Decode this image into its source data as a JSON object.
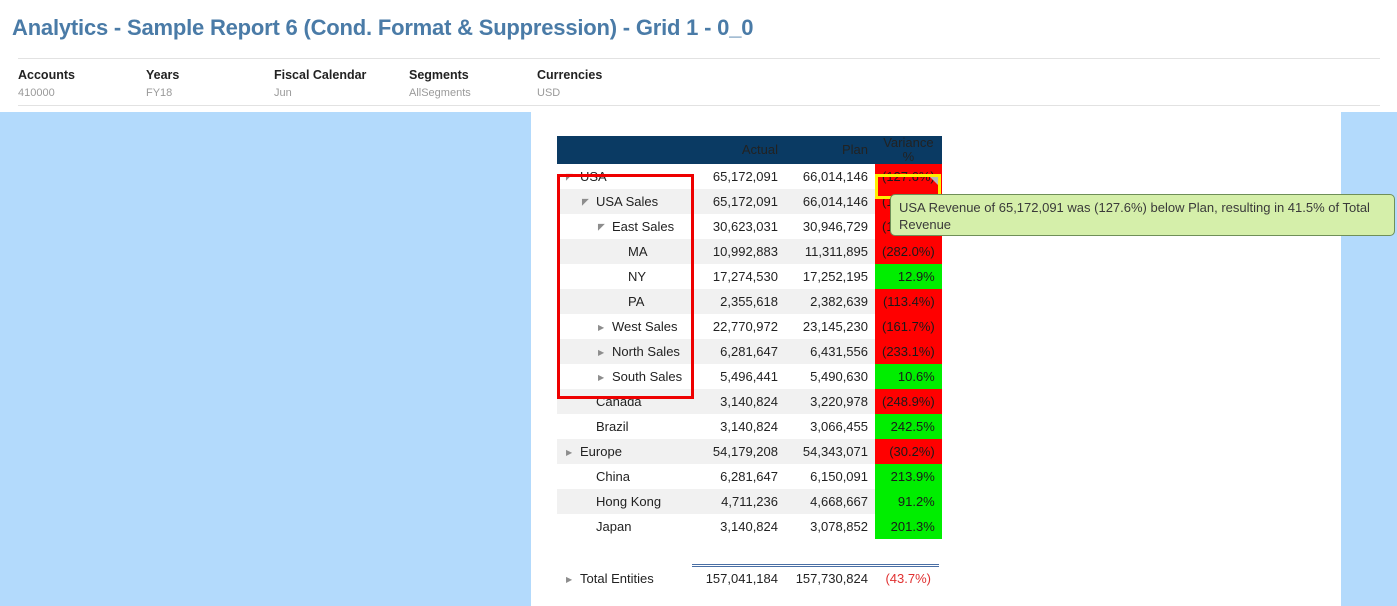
{
  "report": {
    "title": "Analytics - Sample Report 6 (Cond. Format & Suppression) - Grid 1 - 0_0"
  },
  "pov": [
    {
      "label": "Accounts",
      "value": "410000"
    },
    {
      "label": "Years",
      "value": "FY18"
    },
    {
      "label": "Fiscal Calendar",
      "value": "Jun"
    },
    {
      "label": "Segments",
      "value": "AllSegments"
    },
    {
      "label": "Currencies",
      "value": "USD"
    }
  ],
  "grid": {
    "columns": [
      "",
      "Actual",
      "Plan",
      "Variance %"
    ],
    "header": {
      "label": "",
      "actual": "Actual",
      "plan": "Plan",
      "variance_l1": "Variance",
      "variance_l2": "%"
    },
    "rows": [
      {
        "label": "USA",
        "level": 0,
        "toggle": "open",
        "actual": "65,172,091",
        "plan": "66,014,146",
        "variance": "(127.6%)",
        "variance_sign": "neg"
      },
      {
        "label": "USA Sales",
        "level": 1,
        "toggle": "open",
        "actual": "65,172,091",
        "plan": "66,014,146",
        "variance": "(127.6%)",
        "variance_sign": "neg"
      },
      {
        "label": "East Sales",
        "level": 2,
        "toggle": "open",
        "actual": "30,623,031",
        "plan": "30,946,729",
        "variance": "(164.6%)",
        "variance_sign": "neg"
      },
      {
        "label": "MA",
        "level": 3,
        "toggle": "none",
        "actual": "10,992,883",
        "plan": "11,311,895",
        "variance": "(282.0%)",
        "variance_sign": "neg"
      },
      {
        "label": "NY",
        "level": 3,
        "toggle": "none",
        "actual": "17,274,530",
        "plan": "17,252,195",
        "variance": "12.9%",
        "variance_sign": "pos"
      },
      {
        "label": "PA",
        "level": 3,
        "toggle": "none",
        "actual": "2,355,618",
        "plan": "2,382,639",
        "variance": "(113.4%)",
        "variance_sign": "neg"
      },
      {
        "label": "West Sales",
        "level": 2,
        "toggle": "closed",
        "actual": "22,770,972",
        "plan": "23,145,230",
        "variance": "(161.7%)",
        "variance_sign": "neg"
      },
      {
        "label": "North Sales",
        "level": 2,
        "toggle": "closed",
        "actual": "6,281,647",
        "plan": "6,431,556",
        "variance": "(233.1%)",
        "variance_sign": "neg"
      },
      {
        "label": "South Sales",
        "level": 2,
        "toggle": "closed",
        "actual": "5,496,441",
        "plan": "5,490,630",
        "variance": "10.6%",
        "variance_sign": "pos"
      },
      {
        "label": "Canada",
        "level": 1,
        "toggle": "none",
        "actual": "3,140,824",
        "plan": "3,220,978",
        "variance": "(248.9%)",
        "variance_sign": "neg"
      },
      {
        "label": "Brazil",
        "level": 1,
        "toggle": "none",
        "actual": "3,140,824",
        "plan": "3,066,455",
        "variance": "242.5%",
        "variance_sign": "pos"
      },
      {
        "label": "Europe",
        "level": 0,
        "toggle": "closed",
        "actual": "54,179,208",
        "plan": "54,343,071",
        "variance": "(30.2%)",
        "variance_sign": "neg"
      },
      {
        "label": "China",
        "level": 1,
        "toggle": "none",
        "actual": "6,281,647",
        "plan": "6,150,091",
        "variance": "213.9%",
        "variance_sign": "pos"
      },
      {
        "label": "Hong Kong",
        "level": 1,
        "toggle": "none",
        "actual": "4,711,236",
        "plan": "4,668,667",
        "variance": "91.2%",
        "variance_sign": "pos"
      },
      {
        "label": "Japan",
        "level": 1,
        "toggle": "none",
        "actual": "3,140,824",
        "plan": "3,078,852",
        "variance": "201.3%",
        "variance_sign": "pos"
      }
    ],
    "total_row": {
      "label": "Total Entities",
      "toggle": "closed",
      "actual": "157,041,184",
      "plan": "157,730,824",
      "variance": "(43.7%)"
    },
    "selected_cell": {
      "row": "USA",
      "column": "Variance %",
      "value": "(127.6%)"
    }
  },
  "tooltip": {
    "text": "USA Revenue of 65,172,091 was (127.6%) below Plan, resulting in 41.5% of Total Revenue"
  },
  "colors": {
    "title": "#4a7ba7",
    "header_bg": "#0a3a63",
    "canvas_bg": "#b3dafc",
    "negative": "#ff0000",
    "positive": "#00ee00",
    "selection_border": "#ee0000",
    "active_cell_border": "#ffee00",
    "tooltip_bg": "#d5efaa"
  }
}
